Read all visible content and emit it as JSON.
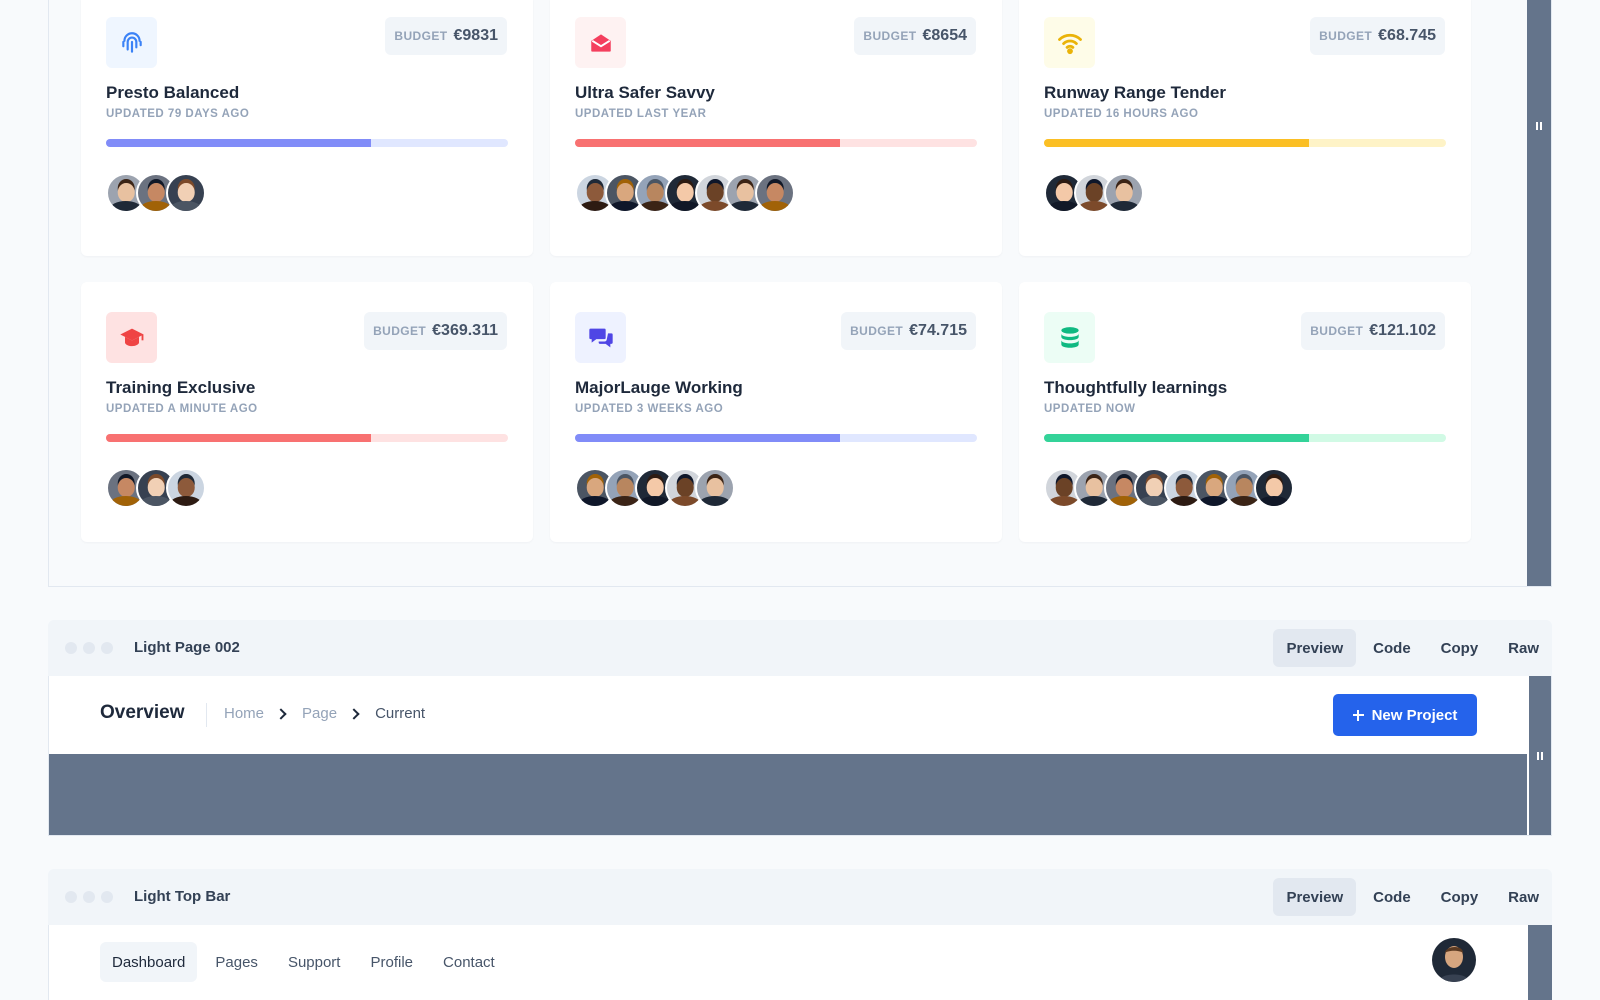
{
  "projects": [
    {
      "title": "Presto Balanced",
      "updated": "UPDATED 79 DAYS AGO",
      "budget_label": "BUDGET",
      "budget": "€9831",
      "icon": "fingerprint-icon",
      "accent": "#818cf8",
      "track": "#e0e7ff",
      "icon_bg": "#eff6ff",
      "icon_color": "#3b82f6",
      "progress": 0.66,
      "members": 3
    },
    {
      "title": "Ultra Safer Savvy",
      "updated": "UPDATED LAST YEAR",
      "budget_label": "BUDGET",
      "budget": "€8654",
      "icon": "envelope-open-icon",
      "accent": "#f87171",
      "track": "#fee2e2",
      "icon_bg": "#fef2f2",
      "icon_color": "#f43f5e",
      "progress": 0.66,
      "members": 7
    },
    {
      "title": "Runway Range Tender",
      "updated": "UPDATED 16 HOURS AGO",
      "budget_label": "BUDGET",
      "budget": "€68.745",
      "icon": "wifi-icon",
      "accent": "#fbbf24",
      "track": "#fef3c7",
      "icon_bg": "#fefce8",
      "icon_color": "#eab308",
      "progress": 0.66,
      "members": 3
    },
    {
      "title": "Training Exclusive",
      "updated": "UPDATED A MINUTE AGO",
      "budget_label": "BUDGET",
      "budget": "€369.311",
      "icon": "graduation-cap-icon",
      "accent": "#f87171",
      "track": "#fee2e2",
      "icon_bg": "#fee2e2",
      "icon_color": "#ef4444",
      "progress": 0.66,
      "members": 3
    },
    {
      "title": "MajorLauge Working",
      "updated": "UPDATED 3 WEEKS AGO",
      "budget_label": "BUDGET",
      "budget": "€74.715",
      "icon": "chat-bubbles-icon",
      "accent": "#818cf8",
      "track": "#e0e7ff",
      "icon_bg": "#eef2ff",
      "icon_color": "#4f46e5",
      "progress": 0.66,
      "members": 5
    },
    {
      "title": "Thoughtfully learnings",
      "updated": "UPDATED NOW",
      "budget_label": "BUDGET",
      "budget": "€121.102",
      "icon": "database-icon",
      "accent": "#34d399",
      "track": "#d1fae5",
      "icon_bg": "#ecfdf5",
      "icon_color": "#10b981",
      "progress": 0.66,
      "members": 8
    }
  ],
  "window2": {
    "title": "Light Page 002",
    "actions": [
      "Preview",
      "Code",
      "Copy",
      "Raw"
    ],
    "active_action": "Preview",
    "page_title": "Overview",
    "breadcrumb": [
      "Home",
      "Page",
      "Current"
    ],
    "new_project": "New Project"
  },
  "window3": {
    "title": "Light Top Bar",
    "actions": [
      "Preview",
      "Code",
      "Copy",
      "Raw"
    ],
    "active_action": "Preview",
    "nav": [
      "Dashboard",
      "Pages",
      "Support",
      "Profile",
      "Contact"
    ],
    "active_nav": "Dashboard"
  },
  "colors": {
    "primary": "#2563eb",
    "slate": "#64748b"
  }
}
